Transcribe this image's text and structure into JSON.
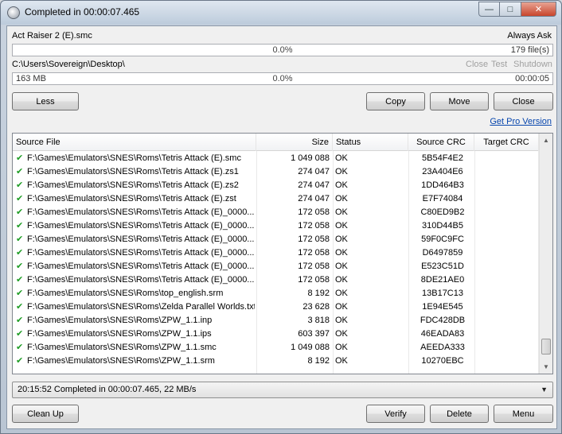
{
  "window": {
    "title": "Completed in 00:00:07.465"
  },
  "job": {
    "current_file": "Act Raiser 2 (E).smc",
    "ask_mode": "Always Ask",
    "file_progress_text": "0.0%",
    "file_progress_value": 0,
    "file_count": "179 file(s)",
    "target_path": "C:\\Users\\Sovereign\\Desktop\\",
    "after_close": "Close",
    "after_test": "Test",
    "after_shutdown": "Shutdown",
    "total_size": "163 MB",
    "total_progress_text": "0.0%",
    "total_progress_value": 0,
    "elapsed": "00:00:05"
  },
  "buttons": {
    "less": "Less",
    "copy": "Copy",
    "move": "Move",
    "close": "Close",
    "get_pro": "Get Pro Version",
    "clean_up": "Clean Up",
    "verify": "Verify",
    "delete": "Delete",
    "menu": "Menu"
  },
  "table": {
    "columns": [
      "Source File",
      "Size",
      "Status",
      "Source CRC",
      "Target CRC"
    ],
    "rows": [
      {
        "src": "F:\\Games\\Emulators\\SNES\\Roms\\Tetris Attack (E).smc",
        "size": "1 049 088",
        "status": "OK",
        "scrc": "5B54F4E2",
        "tcrc": ""
      },
      {
        "src": "F:\\Games\\Emulators\\SNES\\Roms\\Tetris Attack (E).zs1",
        "size": "274 047",
        "status": "OK",
        "scrc": "23A404E6",
        "tcrc": ""
      },
      {
        "src": "F:\\Games\\Emulators\\SNES\\Roms\\Tetris Attack (E).zs2",
        "size": "274 047",
        "status": "OK",
        "scrc": "1DD464B3",
        "tcrc": ""
      },
      {
        "src": "F:\\Games\\Emulators\\SNES\\Roms\\Tetris Attack (E).zst",
        "size": "274 047",
        "status": "OK",
        "scrc": "E7F74084",
        "tcrc": ""
      },
      {
        "src": "F:\\Games\\Emulators\\SNES\\Roms\\Tetris Attack (E)_0000...",
        "size": "172 058",
        "status": "OK",
        "scrc": "C80ED9B2",
        "tcrc": ""
      },
      {
        "src": "F:\\Games\\Emulators\\SNES\\Roms\\Tetris Attack (E)_0000...",
        "size": "172 058",
        "status": "OK",
        "scrc": "310D44B5",
        "tcrc": ""
      },
      {
        "src": "F:\\Games\\Emulators\\SNES\\Roms\\Tetris Attack (E)_0000...",
        "size": "172 058",
        "status": "OK",
        "scrc": "59F0C9FC",
        "tcrc": ""
      },
      {
        "src": "F:\\Games\\Emulators\\SNES\\Roms\\Tetris Attack (E)_0000...",
        "size": "172 058",
        "status": "OK",
        "scrc": "D6497859",
        "tcrc": ""
      },
      {
        "src": "F:\\Games\\Emulators\\SNES\\Roms\\Tetris Attack (E)_0000...",
        "size": "172 058",
        "status": "OK",
        "scrc": "E523C51D",
        "tcrc": ""
      },
      {
        "src": "F:\\Games\\Emulators\\SNES\\Roms\\Tetris Attack (E)_0000...",
        "size": "172 058",
        "status": "OK",
        "scrc": "8DE21AE0",
        "tcrc": ""
      },
      {
        "src": "F:\\Games\\Emulators\\SNES\\Roms\\top_english.srm",
        "size": "8 192",
        "status": "OK",
        "scrc": "13B17C13",
        "tcrc": ""
      },
      {
        "src": "F:\\Games\\Emulators\\SNES\\Roms\\Zelda Parallel Worlds.txt",
        "size": "23 628",
        "status": "OK",
        "scrc": "1E94E545",
        "tcrc": ""
      },
      {
        "src": "F:\\Games\\Emulators\\SNES\\Roms\\ZPW_1.1.inp",
        "size": "3 818",
        "status": "OK",
        "scrc": "FDC428DB",
        "tcrc": ""
      },
      {
        "src": "F:\\Games\\Emulators\\SNES\\Roms\\ZPW_1.1.ips",
        "size": "603 397",
        "status": "OK",
        "scrc": "46EADA83",
        "tcrc": ""
      },
      {
        "src": "F:\\Games\\Emulators\\SNES\\Roms\\ZPW_1.1.smc",
        "size": "1 049 088",
        "status": "OK",
        "scrc": "AEEDA333",
        "tcrc": ""
      },
      {
        "src": "F:\\Games\\Emulators\\SNES\\Roms\\ZPW_1.1.srm",
        "size": "8 192",
        "status": "OK",
        "scrc": "10270EBC",
        "tcrc": ""
      }
    ]
  },
  "status_bar": {
    "text": "20:15:52 Completed in 00:00:07.465, 22 MB/s"
  },
  "icons": {
    "app": "app-icon",
    "check": "check-icon"
  },
  "colors": {
    "progress_fill": "#06b025",
    "check": "#1e9c24",
    "link": "#0645ad"
  }
}
